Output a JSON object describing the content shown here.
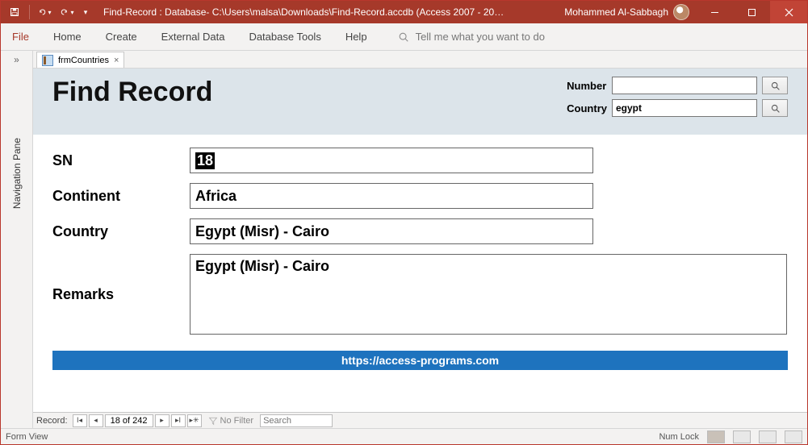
{
  "titlebar": {
    "text": "Find-Record : Database- C:\\Users\\malsa\\Downloads\\Find-Record.accdb (Access 2007 - 20…",
    "user": "Mohammed Al-Sabbagh"
  },
  "menu": {
    "file": "File",
    "home": "Home",
    "create": "Create",
    "external": "External Data",
    "dbtools": "Database Tools",
    "help": "Help",
    "tellme": "Tell me what you want to do"
  },
  "nav": {
    "collapse": "»",
    "label": "Navigation Pane"
  },
  "tab": {
    "name": "frmCountries",
    "close": "×"
  },
  "form": {
    "title": "Find Record",
    "search": {
      "number_label": "Number",
      "number_value": "",
      "country_label": "Country",
      "country_value": "egypt"
    },
    "fields": {
      "sn_label": "SN",
      "sn_value": "18",
      "continent_label": "Continent",
      "continent_value": "Africa",
      "country_label": "Country",
      "country_value": "Egypt (Misr) - Cairo",
      "remarks_label": "Remarks",
      "remarks_value": "Egypt (Misr) - Cairo"
    },
    "footer_link": "https://access-programs.com"
  },
  "recordnav": {
    "label": "Record:",
    "pos": "18 of 242",
    "nofilter": "No Filter",
    "search_placeholder": "Search"
  },
  "status": {
    "left": "Form View",
    "numlock": "Num Lock"
  }
}
